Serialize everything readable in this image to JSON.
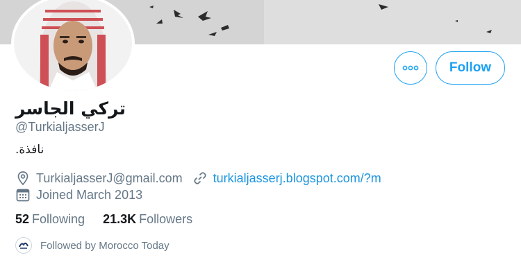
{
  "profile": {
    "display_name": "تركي الجاسر",
    "handle": "@TurkialjasserJ",
    "bio": "نافذة.",
    "email": "TurkialjasserJ@gmail.com",
    "website": "turkialjasserj.blogspot.com/?m",
    "joined": "Joined March 2013"
  },
  "actions": {
    "follow_label": "Follow",
    "more_icon": "more-dots-icon"
  },
  "stats": {
    "following_count": "52",
    "following_label": "Following",
    "followers_count": "21.3K",
    "followers_label": "Followers"
  },
  "followed_by": {
    "text": "Followed by Morocco Today"
  },
  "colors": {
    "accent": "#1da1f2",
    "link": "#1b95e0",
    "secondary_text": "#657786",
    "primary_text": "#14171a"
  }
}
